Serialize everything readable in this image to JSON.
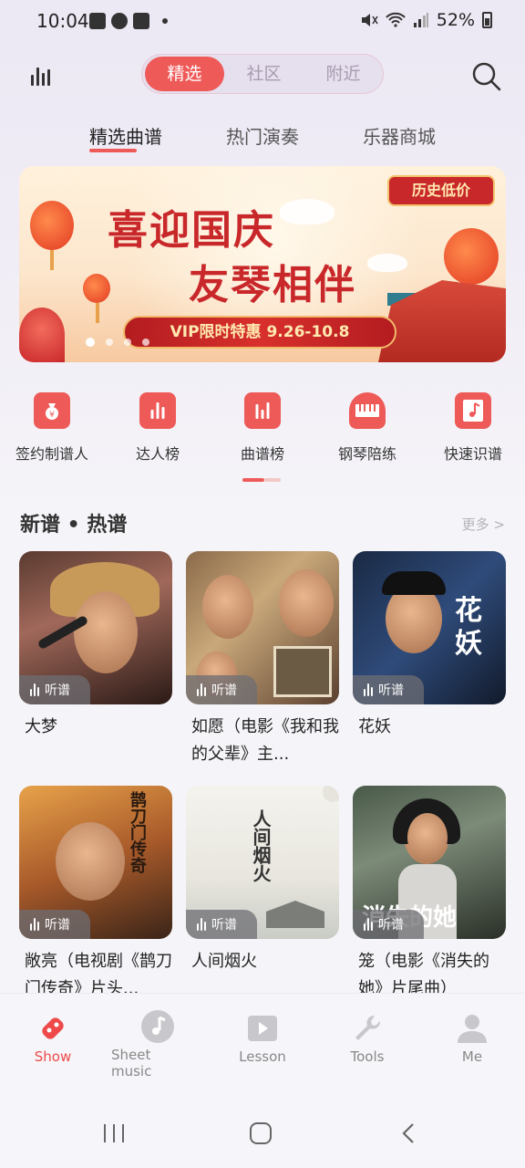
{
  "status": {
    "time": "10:04",
    "battery": "52%"
  },
  "header": {
    "segments": [
      "精选",
      "社区",
      "附近"
    ],
    "active_segment": "精选"
  },
  "tabs": [
    "精选曲谱",
    "热门演奏",
    "乐器商城"
  ],
  "banner": {
    "line1": "喜迎国庆",
    "line2": "友琴相伴",
    "badge": "历史低价",
    "vip": "VIP限时特惠 9.26-10.8"
  },
  "quick_links": [
    "签约制谱人",
    "达人榜",
    "曲谱榜",
    "钢琴陪练",
    "快速识谱"
  ],
  "section": {
    "title": "新谱 • 热谱",
    "more": "更多 >"
  },
  "listen_label": "听谱",
  "cards": [
    {
      "title": "大梦"
    },
    {
      "title": "如愿（电影《我和我的父辈》主..."
    },
    {
      "title": "花妖"
    },
    {
      "title": "敞亮（电视剧《鹊刀门传奇》片头..."
    },
    {
      "title": "人间烟火"
    },
    {
      "title": "笼（电影《消失的她》片尾曲）"
    }
  ],
  "thumb_text": {
    "huayao": "花\n妖",
    "que": "鹊刀门传奇",
    "renjian": "人间烟火",
    "xiaoshi": "消失的她"
  },
  "bottom_nav": [
    "Show",
    "Sheet music",
    "Lesson",
    "Tools",
    "Me"
  ],
  "colors": {
    "accent": "#ee5a58",
    "banner_red": "#c9282b"
  }
}
